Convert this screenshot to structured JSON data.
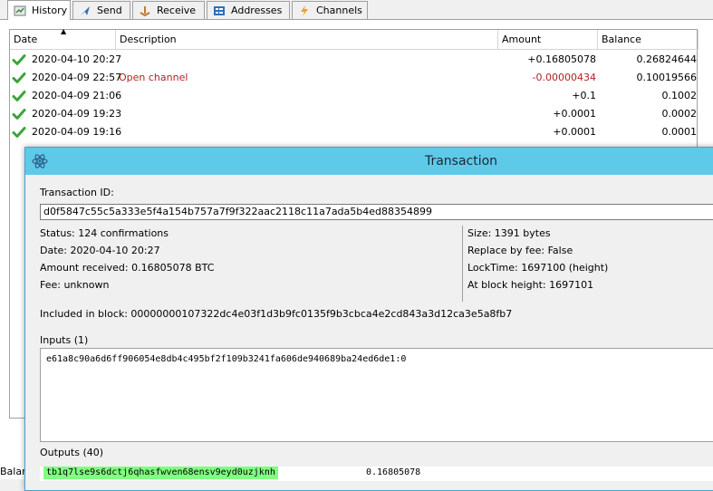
{
  "tabs": [
    {
      "label": "History",
      "icon": "history-icon",
      "active": true
    },
    {
      "label": "Send",
      "icon": "send-icon",
      "active": false
    },
    {
      "label": "Receive",
      "icon": "receive-icon",
      "active": false
    },
    {
      "label": "Addresses",
      "icon": "addresses-icon",
      "active": false
    },
    {
      "label": "Channels",
      "icon": "lightning-icon",
      "active": false
    }
  ],
  "history": {
    "columns": [
      "Date",
      "Description",
      "Amount",
      "Balance"
    ],
    "sort_column": "Date",
    "rows": [
      {
        "date": "2020-04-10 20:27",
        "description": "",
        "amount": "+0.16805078",
        "balance": "0.26824644",
        "status_icon": "confirmed-check-icon"
      },
      {
        "date": "2020-04-09 22:57",
        "description": "Open channel",
        "amount": "-0.00000434",
        "balance": "0.10019566",
        "status_icon": "confirmed-check-icon"
      },
      {
        "date": "2020-04-09 21:06",
        "description": "",
        "amount": "+0.1",
        "balance": "0.1002",
        "status_icon": "confirmed-check-icon"
      },
      {
        "date": "2020-04-09 19:23",
        "description": "",
        "amount": "+0.0001",
        "balance": "0.0002",
        "status_icon": "confirmed-check-icon"
      },
      {
        "date": "2020-04-09 19:16",
        "description": "",
        "amount": "+0.0001",
        "balance": "0.0001",
        "status_icon": "confirmed-check-icon"
      }
    ]
  },
  "status_bar": {
    "balance_label_fragment": "Balan"
  },
  "dialog": {
    "title": "Transaction",
    "title_icon": "electrum-logo-icon",
    "txid_label": "Transaction ID:",
    "txid": "d0f5847c55c5a333e5f4a154b757a7f9f322aac2118c11a7ada5b4ed88354899",
    "left_info": [
      "Status: 124 confirmations",
      "Date: 2020-04-10 20:27",
      "Amount received: 0.16805078 BTC",
      "Fee: unknown"
    ],
    "right_info": [
      "Size: 1391 bytes",
      "Replace by fee: False",
      "LockTime: 1697100 (height)",
      "At block height: 1697101"
    ],
    "included_in_block": "Included in block: 00000000107322dc4e03f1d3b9fc0135f9b3cbca4e2cd843a3d12ca3e5a8fb7",
    "inputs_label": "Inputs (1)",
    "inputs": [
      "e61a8c90a6d6ff906054e8db4c495bf2f109b3241fa606de940689ba24ed6de1:0"
    ],
    "outputs_label": "Outputs (40)",
    "outputs": [
      {
        "address": "tb1q7lse9s6dctj6qhasfwven68ensv9eyd0uzjknh",
        "amount": "0.16805078",
        "highlight": "#80ff80"
      }
    ]
  },
  "colors": {
    "title_bar": "#5fc9ea",
    "negative_amount": "#b22222",
    "own_address_highlight": "#80ff80",
    "check_green": "#3aa63a"
  }
}
